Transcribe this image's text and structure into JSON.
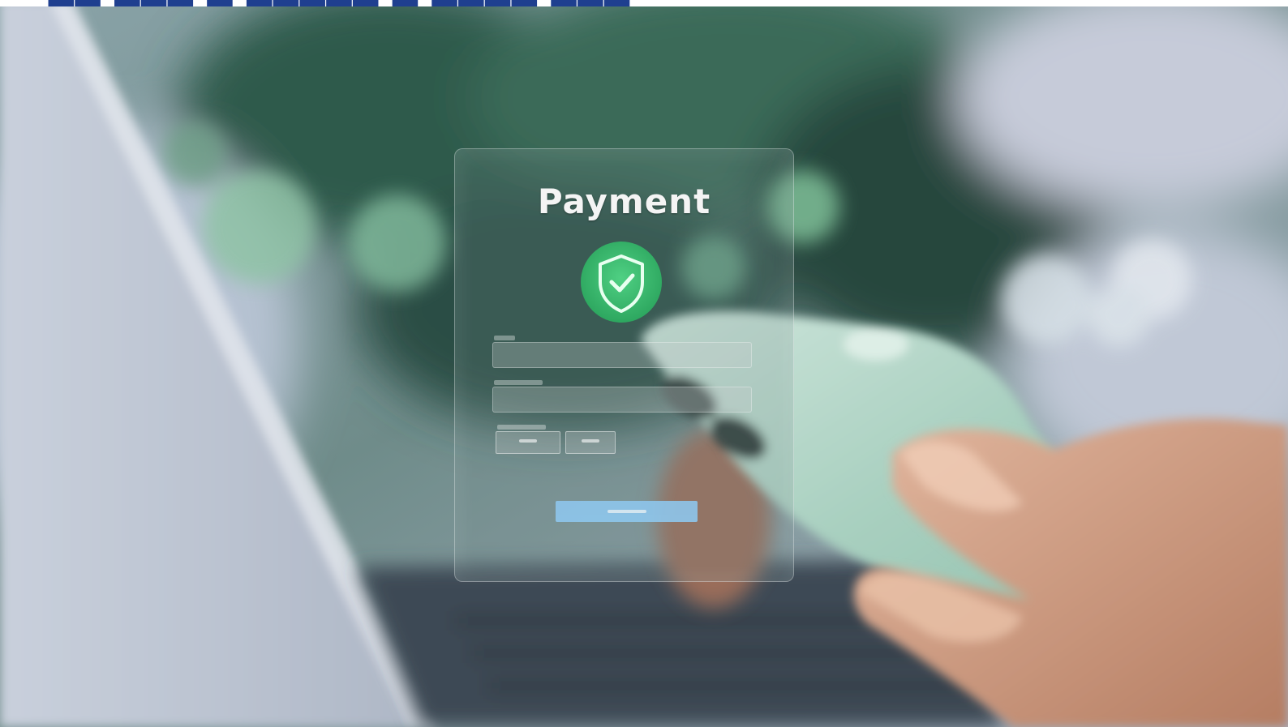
{
  "panel": {
    "title": "Payment",
    "shield_icon": "shield-check-icon",
    "accent_color": "#3bbf6e",
    "button_color": "#8ec6ec"
  }
}
